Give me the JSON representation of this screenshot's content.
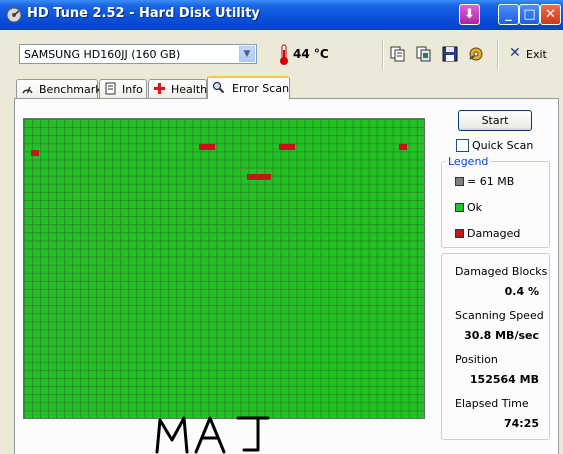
{
  "window": {
    "title": "HD Tune 2.52 - Hard Disk Utility",
    "icon": "hdtune-app-icon"
  },
  "titlebar_buttons": [
    "extra-down-arrow-icon",
    "minimize-icon",
    "maximize-icon",
    "close-icon"
  ],
  "toolbar": {
    "drive": "SAMSUNG HD160JJ (160 GB)",
    "temperature": "44 °C",
    "icons": [
      "copy-text-icon",
      "copy-screenshot-icon",
      "save-icon",
      "options-icon"
    ],
    "exit_label": "Exit"
  },
  "tabs": [
    {
      "label": "Benchmark",
      "icon": "benchmark-icon"
    },
    {
      "label": "Info",
      "icon": "info-icon"
    },
    {
      "label": "Health",
      "icon": "health-icon"
    },
    {
      "label": "Error Scan",
      "icon": "magnifier-icon",
      "active": true
    }
  ],
  "scan": {
    "start_label": "Start",
    "quick_scan_label": "Quick Scan",
    "quick_scan_checked": false,
    "grid_colors": {
      "ok": "#23c323",
      "damaged": "#c01818",
      "block": "#808080"
    }
  },
  "legend": {
    "title": "Legend",
    "items": [
      {
        "color": "#808080",
        "label": "= 61 MB"
      },
      {
        "color": "#23c323",
        "label": "Ok"
      },
      {
        "color": "#c01818",
        "label": "Damaged"
      }
    ]
  },
  "stats": [
    {
      "label": "Damaged Blocks",
      "value": "0.4 %"
    },
    {
      "label": "Scanning Speed",
      "value": "30.8 MB/sec"
    },
    {
      "label": "Position",
      "value": "152564 MB"
    },
    {
      "label": "Elapsed Time",
      "value": "74:25"
    }
  ],
  "annotation": "MAJ"
}
